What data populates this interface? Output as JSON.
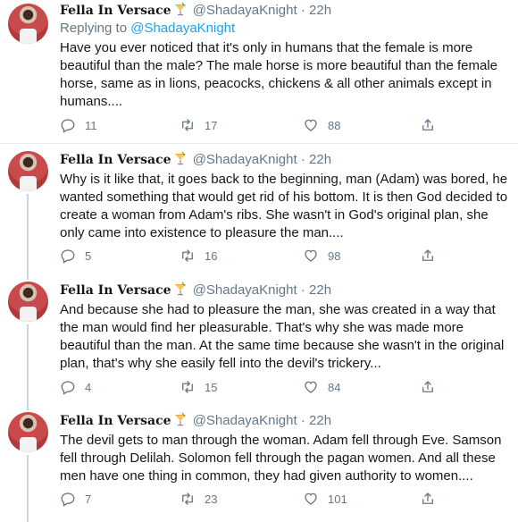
{
  "tweets": [
    {
      "name": "Fella In Versace",
      "handle": "@ShadayaKnight",
      "dot": "·",
      "time": "22h",
      "reply_prefix": "Replying to ",
      "reply_to": "@ShadayaKnight",
      "text": "Have you ever noticed that it's only in humans that the female is more beautiful than the male? The male horse is more beautiful than the female horse, same as in lions, peacocks, chickens & all other animals except in humans....",
      "replies": "11",
      "retweets": "17",
      "likes": "88"
    },
    {
      "name": "Fella In Versace",
      "handle": "@ShadayaKnight",
      "dot": "·",
      "time": "22h",
      "text": "Why is it like that, it goes back to the beginning, man (Adam) was bored, he wanted something that would get rid of his bottom. It is then God decided to create a woman from Adam's ribs. She wasn't in God's original plan, she only came into existence to pleasure the man....",
      "replies": "5",
      "retweets": "16",
      "likes": "98"
    },
    {
      "name": "Fella In Versace",
      "handle": "@ShadayaKnight",
      "dot": "·",
      "time": "22h",
      "text": "And because she had to pleasure the man, she was created in a way that the man would find her pleasurable. That's why she was made more beautiful than the man. At the same time because she wasn't in the original plan, that's why she easily fell into the devil's trickery...",
      "replies": "4",
      "retweets": "15",
      "likes": "84"
    },
    {
      "name": "Fella In Versace",
      "handle": "@ShadayaKnight",
      "dot": "·",
      "time": "22h",
      "text": "The devil gets to man through the woman. Adam fell through Eve. Samson fell through Delilah. Solomon fell through the pagan women. And all these men have one thing in common, they had given authority to women....",
      "replies": "7",
      "retweets": "23",
      "likes": "101"
    }
  ],
  "icons": {
    "reply": "reply-icon",
    "retweet": "retweet-icon",
    "like": "heart-icon",
    "share": "share-icon",
    "emoji": "cocktail-emoji-icon"
  },
  "colors": {
    "link": "#1da1f2",
    "secondary": "#657786",
    "text": "#14171a",
    "divider": "#e6ecf0"
  }
}
